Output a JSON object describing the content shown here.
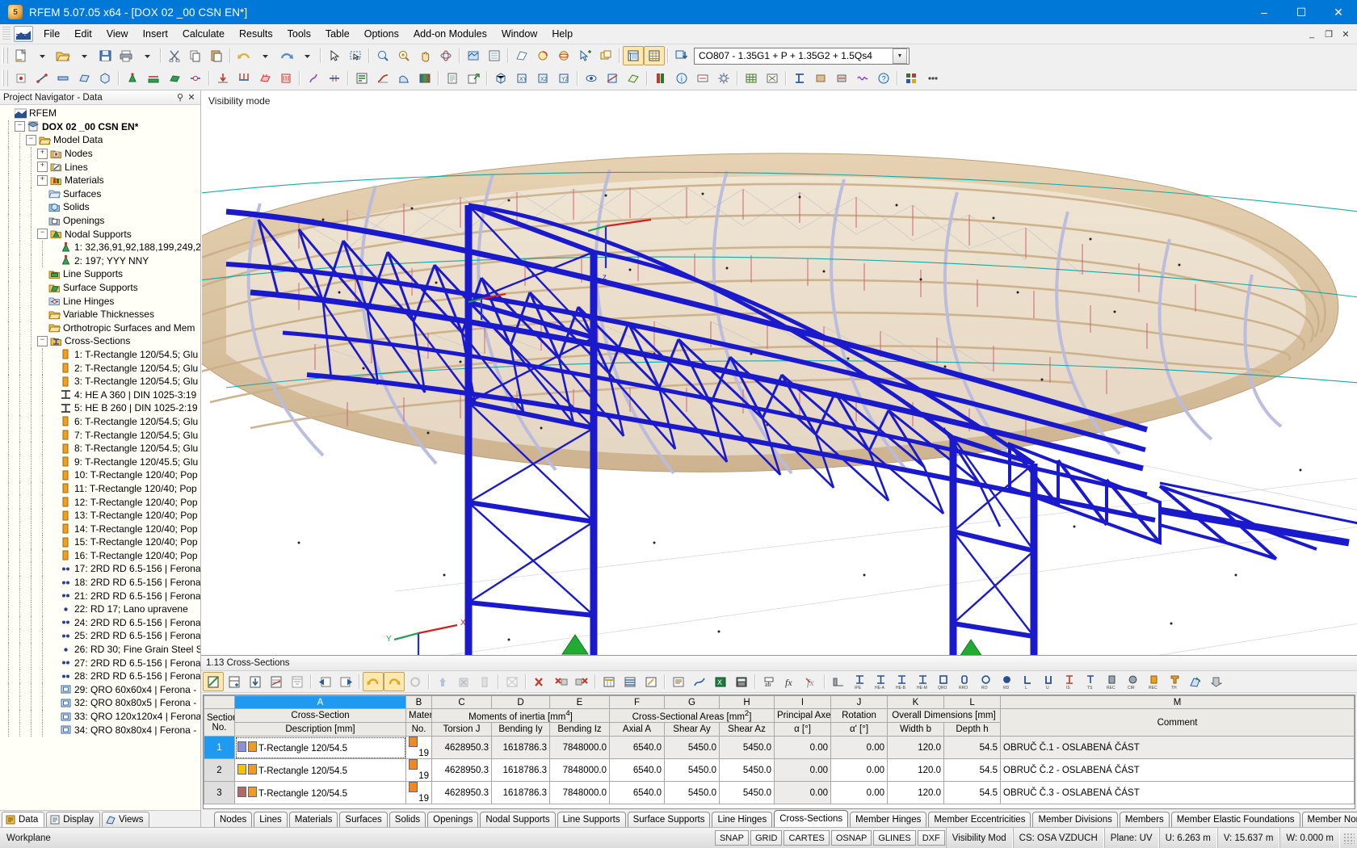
{
  "window": {
    "title": "RFEM 5.07.05 x64 - [DOX 02 _00 CSN EN*]",
    "app_icon": "rfem-logo-icon",
    "minimize": "–",
    "maximize": "☐",
    "close": "✕",
    "inner_minimize": "_",
    "inner_restore": "❐",
    "inner_close": "✕"
  },
  "menu": [
    {
      "label": "File"
    },
    {
      "label": "Edit"
    },
    {
      "label": "View"
    },
    {
      "label": "Insert"
    },
    {
      "label": "Calculate"
    },
    {
      "label": "Results"
    },
    {
      "label": "Tools"
    },
    {
      "label": "Table"
    },
    {
      "label": "Options"
    },
    {
      "label": "Add-on Modules"
    },
    {
      "label": "Window"
    },
    {
      "label": "Help"
    }
  ],
  "toolbar": {
    "load_case_combo": "CO807 - 1.35G1 + P + 1.35G2 + 1.5Qs4",
    "combo_arrow": "▼"
  },
  "navigator": {
    "title": "Project Navigator - Data",
    "pin": "⚲",
    "close": "✕",
    "tree": [
      {
        "depth": 0,
        "expander": "",
        "icon": "rfem-root-icon",
        "label": "RFEM",
        "bold": false
      },
      {
        "depth": 1,
        "expander": "−",
        "icon": "project-icon",
        "label": "DOX 02 _00 CSN EN*",
        "bold": true
      },
      {
        "depth": 2,
        "expander": "−",
        "icon": "folder-icon",
        "label": "Model Data",
        "bold": false
      },
      {
        "depth": 3,
        "expander": "+",
        "icon": "nodes-icon",
        "label": "Nodes",
        "bold": false
      },
      {
        "depth": 3,
        "expander": "+",
        "icon": "lines-icon",
        "label": "Lines",
        "bold": false
      },
      {
        "depth": 3,
        "expander": "+",
        "icon": "materials-icon",
        "label": "Materials",
        "bold": false
      },
      {
        "depth": 3,
        "expander": "",
        "icon": "surfaces-icon",
        "label": "Surfaces",
        "bold": false
      },
      {
        "depth": 3,
        "expander": "",
        "icon": "solids-icon",
        "label": "Solids",
        "bold": false
      },
      {
        "depth": 3,
        "expander": "",
        "icon": "openings-icon",
        "label": "Openings",
        "bold": false
      },
      {
        "depth": 3,
        "expander": "−",
        "icon": "nodal-supports-icon",
        "label": "Nodal Supports",
        "bold": false
      },
      {
        "depth": 4,
        "expander": "",
        "icon": "support-icon",
        "label": "1: 32,36,91,92,188,199,249,2",
        "bold": false
      },
      {
        "depth": 4,
        "expander": "",
        "icon": "support-icon",
        "label": "2: 197; YYY NNY",
        "bold": false
      },
      {
        "depth": 3,
        "expander": "",
        "icon": "line-supports-icon",
        "label": "Line Supports",
        "bold": false
      },
      {
        "depth": 3,
        "expander": "",
        "icon": "surface-supports-icon",
        "label": "Surface Supports",
        "bold": false
      },
      {
        "depth": 3,
        "expander": "",
        "icon": "line-hinges-icon",
        "label": "Line Hinges",
        "bold": false
      },
      {
        "depth": 3,
        "expander": "",
        "icon": "folder-icon",
        "label": "Variable Thicknesses",
        "bold": false
      },
      {
        "depth": 3,
        "expander": "",
        "icon": "folder-icon",
        "label": "Orthotropic Surfaces and Mem",
        "bold": false
      },
      {
        "depth": 3,
        "expander": "−",
        "icon": "cross-sections-icon",
        "label": "Cross-Sections",
        "bold": false
      },
      {
        "depth": 4,
        "expander": "",
        "icon": "section-rect-icon",
        "label": "1: T-Rectangle 120/54.5; Glu",
        "bold": false
      },
      {
        "depth": 4,
        "expander": "",
        "icon": "section-rect-icon",
        "label": "2: T-Rectangle 120/54.5; Glu",
        "bold": false
      },
      {
        "depth": 4,
        "expander": "",
        "icon": "section-rect-icon",
        "label": "3: T-Rectangle 120/54.5; Glu",
        "bold": false
      },
      {
        "depth": 4,
        "expander": "",
        "icon": "section-i-icon",
        "label": "4: HE A 360 | DIN 1025-3:19",
        "bold": false
      },
      {
        "depth": 4,
        "expander": "",
        "icon": "section-i-icon",
        "label": "5: HE B 260 | DIN 1025-2:19",
        "bold": false
      },
      {
        "depth": 4,
        "expander": "",
        "icon": "section-rect-icon",
        "label": "6: T-Rectangle 120/54.5; Glu",
        "bold": false
      },
      {
        "depth": 4,
        "expander": "",
        "icon": "section-rect-icon",
        "label": "7: T-Rectangle 120/54.5; Glu",
        "bold": false
      },
      {
        "depth": 4,
        "expander": "",
        "icon": "section-rect-icon",
        "label": "8: T-Rectangle 120/54.5; Glu",
        "bold": false
      },
      {
        "depth": 4,
        "expander": "",
        "icon": "section-rect-icon",
        "label": "9: T-Rectangle 120/45.5; Glu",
        "bold": false
      },
      {
        "depth": 4,
        "expander": "",
        "icon": "section-rect-icon",
        "label": "10: T-Rectangle 120/40; Pop",
        "bold": false
      },
      {
        "depth": 4,
        "expander": "",
        "icon": "section-rect-icon",
        "label": "11: T-Rectangle 120/40; Pop",
        "bold": false
      },
      {
        "depth": 4,
        "expander": "",
        "icon": "section-rect-icon",
        "label": "12: T-Rectangle 120/40; Pop",
        "bold": false
      },
      {
        "depth": 4,
        "expander": "",
        "icon": "section-rect-icon",
        "label": "13: T-Rectangle 120/40; Pop",
        "bold": false
      },
      {
        "depth": 4,
        "expander": "",
        "icon": "section-rect-icon",
        "label": "14: T-Rectangle 120/40; Pop",
        "bold": false
      },
      {
        "depth": 4,
        "expander": "",
        "icon": "section-rect-icon",
        "label": "15: T-Rectangle 120/40; Pop",
        "bold": false
      },
      {
        "depth": 4,
        "expander": "",
        "icon": "section-rect-icon",
        "label": "16: T-Rectangle 120/40; Pop",
        "bold": false
      },
      {
        "depth": 4,
        "expander": "",
        "icon": "section-2rd-icon",
        "label": "17: 2RD RD 6.5-156 | Ferona",
        "bold": false
      },
      {
        "depth": 4,
        "expander": "",
        "icon": "section-2rd-icon",
        "label": "18: 2RD RD 6.5-156 | Ferona",
        "bold": false
      },
      {
        "depth": 4,
        "expander": "",
        "icon": "section-2rd-icon",
        "label": "21: 2RD RD 6.5-156 | Ferona",
        "bold": false
      },
      {
        "depth": 4,
        "expander": "",
        "icon": "section-rd-icon",
        "label": "22: RD 17; Lano upravene",
        "bold": false
      },
      {
        "depth": 4,
        "expander": "",
        "icon": "section-2rd-icon",
        "label": "24: 2RD RD 6.5-156 | Ferona",
        "bold": false
      },
      {
        "depth": 4,
        "expander": "",
        "icon": "section-2rd-icon",
        "label": "25: 2RD RD 6.5-156 | Ferona",
        "bold": false
      },
      {
        "depth": 4,
        "expander": "",
        "icon": "section-rd-icon",
        "label": "26: RD 30; Fine Grain Steel S",
        "bold": false
      },
      {
        "depth": 4,
        "expander": "",
        "icon": "section-2rd-icon",
        "label": "27: 2RD RD 6.5-156 | Ferona",
        "bold": false
      },
      {
        "depth": 4,
        "expander": "",
        "icon": "section-2rd-icon",
        "label": "28: 2RD RD 6.5-156 | Ferona",
        "bold": false
      },
      {
        "depth": 4,
        "expander": "",
        "icon": "section-qro-icon",
        "label": "29: QRO 60x60x4 | Ferona -",
        "bold": false
      },
      {
        "depth": 4,
        "expander": "",
        "icon": "section-qro-icon",
        "label": "32: QRO 80x80x5 | Ferona -",
        "bold": false
      },
      {
        "depth": 4,
        "expander": "",
        "icon": "section-qro-icon",
        "label": "33: QRO 120x120x4 | Ferona",
        "bold": false
      },
      {
        "depth": 4,
        "expander": "",
        "icon": "section-qro-icon",
        "label": "34: QRO 80x80x4 | Ferona -",
        "bold": false
      }
    ],
    "bottom_tabs": [
      {
        "label": "Data",
        "icon": "data-icon",
        "selected": true
      },
      {
        "label": "Display",
        "icon": "display-icon",
        "selected": false
      },
      {
        "label": "Views",
        "icon": "views-icon",
        "selected": false
      }
    ]
  },
  "viewport": {
    "visibility_mode_label": "Visibility mode",
    "axis_labels": {
      "x": "X",
      "y": "Y",
      "z": "Z",
      "local_z": "z"
    },
    "colors": {
      "structure_blue": "#1a1acc",
      "timber_tan": "#d9bd95",
      "arch_lavender": "#b9bbdd",
      "teal_line": "#00a0a0",
      "red_member": "#cc6677"
    }
  },
  "table": {
    "caption": "1.13 Cross-Sections",
    "column_ids": [
      "A",
      "B",
      "C",
      "D",
      "E",
      "F",
      "G",
      "H",
      "I",
      "J",
      "K",
      "L",
      "M"
    ],
    "selected_column": "A",
    "group_headers": [
      {
        "label": "Section",
        "span": 1
      },
      {
        "label": "Cross-Section",
        "span": 1
      },
      {
        "label": "Material",
        "span": 1
      },
      {
        "label": "Moments of inertia [mm 4]",
        "span": 3
      },
      {
        "label": "Cross-Sectional Areas [mm 2]",
        "span": 3
      },
      {
        "label": "Principal Axes",
        "span": 1
      },
      {
        "label": "Rotation",
        "span": 1
      },
      {
        "label": "Overall Dimensions [mm]",
        "span": 2
      },
      {
        "label": "",
        "span": 1
      }
    ],
    "sub_headers": [
      "No.",
      "Description [mm]",
      "No.",
      "Torsion J",
      "Bending Iy",
      "Bending Iz",
      "Axial A",
      "Shear Ay",
      "Shear Az",
      "α [°]",
      "α' [°]",
      "Width b",
      "Depth h",
      "Comment"
    ],
    "group_header_titles": {
      "section": "Section",
      "cross_section": "Cross-Section",
      "material": "Material",
      "moments": "Moments of inertia [mm",
      "moments_sup": "4",
      "moments_close": "]",
      "areas": "Cross-Sectional Areas [mm",
      "areas_sup": "2",
      "areas_close": "]",
      "principal_axes": "Principal Axes",
      "rotation": "Rotation",
      "overall": "Overall Dimensions [mm]",
      "comment": "Comment"
    },
    "rows": [
      {
        "no": "1",
        "color1": "#8e90d6",
        "color2": "#f09a1e",
        "description": "T-Rectangle 120/54.5",
        "material_color": "#f08a1e",
        "material_no": "19",
        "torsion_j": "4628950.3",
        "bending_iy": "1618786.3",
        "bending_iz": "7848000.0",
        "axial_a": "6540.0",
        "shear_ay": "5450.0",
        "shear_az": "5450.0",
        "alpha": "0.00",
        "alpha_rot": "0.00",
        "width_b": "120.0",
        "depth_h": "54.5",
        "comment": "OBRUČ Č.1 - OSLABENÁ ČÁST",
        "selected": true
      },
      {
        "no": "2",
        "color1": "#f2c400",
        "color2": "#f09a1e",
        "description": "T-Rectangle 120/54.5",
        "material_color": "#f08a1e",
        "material_no": "19",
        "torsion_j": "4628950.3",
        "bending_iy": "1618786.3",
        "bending_iz": "7848000.0",
        "axial_a": "6540.0",
        "shear_ay": "5450.0",
        "shear_az": "5450.0",
        "alpha": "0.00",
        "alpha_rot": "0.00",
        "width_b": "120.0",
        "depth_h": "54.5",
        "comment": "OBRUČ Č.2 - OSLABENÁ ČÁST",
        "selected": false
      },
      {
        "no": "3",
        "color1": "#b06a6a",
        "color2": "#f09a1e",
        "description": "T-Rectangle 120/54.5",
        "material_color": "#f08a1e",
        "material_no": "19",
        "torsion_j": "4628950.3",
        "bending_iy": "1618786.3",
        "bending_iz": "7848000.0",
        "axial_a": "6540.0",
        "shear_ay": "5450.0",
        "shear_az": "5450.0",
        "alpha": "0.00",
        "alpha_rot": "0.00",
        "width_b": "120.0",
        "depth_h": "54.5",
        "comment": "OBRUČ Č.3 - OSLABENÁ ČÁST",
        "selected": false
      }
    ],
    "tabs": [
      {
        "label": "Nodes",
        "selected": false
      },
      {
        "label": "Lines",
        "selected": false
      },
      {
        "label": "Materials",
        "selected": false
      },
      {
        "label": "Surfaces",
        "selected": false
      },
      {
        "label": "Solids",
        "selected": false
      },
      {
        "label": "Openings",
        "selected": false
      },
      {
        "label": "Nodal Supports",
        "selected": false
      },
      {
        "label": "Line Supports",
        "selected": false
      },
      {
        "label": "Surface Supports",
        "selected": false
      },
      {
        "label": "Line Hinges",
        "selected": false
      },
      {
        "label": "Cross-Sections",
        "selected": true
      },
      {
        "label": "Member Hinges",
        "selected": false
      },
      {
        "label": "Member Eccentricities",
        "selected": false
      },
      {
        "label": "Member Divisions",
        "selected": false
      },
      {
        "label": "Members",
        "selected": false
      },
      {
        "label": "Member Elastic Foundations",
        "selected": false
      },
      {
        "label": "Member Nonlinearities",
        "selected": false
      }
    ]
  },
  "statusbar": {
    "workplane": "Workplane",
    "toggles": [
      "SNAP",
      "GRID",
      "CARTES",
      "OSNAP",
      "GLINES",
      "DXF"
    ],
    "visibility_mode": "Visibility Mod",
    "cs": "CS: OSA VZDUCH",
    "plane": "Plane: UV",
    "u": "U:  6.263 m",
    "v": "V:  15.637 m",
    "w": "W:  0.000 m"
  }
}
